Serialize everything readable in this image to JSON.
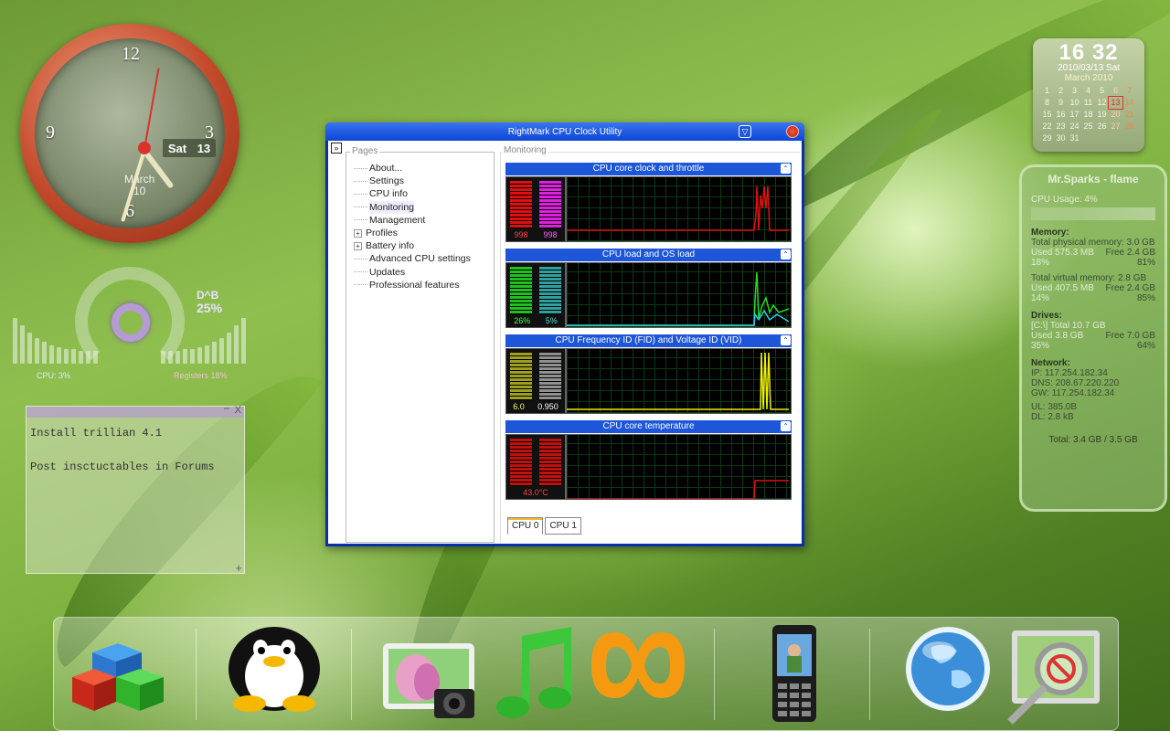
{
  "clock": {
    "numbers": [
      "12",
      "3",
      "6",
      "9"
    ],
    "day": "Sat",
    "date": "13",
    "month": "March",
    "month_day": "10"
  },
  "meter": {
    "title": "D^B",
    "percent": "25%",
    "cpu_label": "CPU: 3%",
    "register_label": "Registers 18%"
  },
  "notes": {
    "lines": [
      "Install trillian 4.1",
      "Post insctuctables in Forums"
    ]
  },
  "calendar": {
    "time": "16 32",
    "date": "2010/03/13 Sat",
    "month": "March 2010",
    "days": [
      [
        "1",
        "2",
        "3",
        "4",
        "5",
        "6",
        "7"
      ],
      [
        "8",
        "9",
        "10",
        "11",
        "12",
        "13",
        "14"
      ],
      [
        "15",
        "16",
        "17",
        "18",
        "19",
        "20",
        "21"
      ],
      [
        "22",
        "23",
        "24",
        "25",
        "26",
        "27",
        "28"
      ],
      [
        "29",
        "30",
        "31",
        "",
        "",
        "",
        ""
      ]
    ],
    "today": "13"
  },
  "stats": {
    "title": "Mr.Sparks - flame",
    "cpu_usage": "CPU Usage: 4%",
    "memory_heading": "Memory:",
    "physical_total": "Total physical memory: 3.0 GB",
    "physical_used": "Used 575.3 MB",
    "physical_free": "Free 2.4 GB",
    "physical_used_pct": "18%",
    "physical_free_pct": "81%",
    "virtual_total": "Total virtual memory: 2.8 GB",
    "virtual_used": "Used 407.5 MB",
    "virtual_free": "Free 2.4 GB",
    "virtual_used_pct": "14%",
    "virtual_free_pct": "85%",
    "drives_heading": "Drives:",
    "drive_total": "[C:\\] Total 10.7 GB",
    "drive_used": "Used 3.8 GB",
    "drive_free": "Free 7.0 GB",
    "drive_used_pct": "35%",
    "drive_free_pct": "64%",
    "network_heading": "Network:",
    "ip": "IP:   117.254.182.34",
    "dns": "DNS: 208.67.220.220",
    "gw": "GW:  117.254.182.34",
    "ul": "UL: 385.0B",
    "dl": "DL: 2.8 kB",
    "total": "Total: 3.4 GB / 3.5 GB"
  },
  "window": {
    "title": "RightMark CPU Clock Utility",
    "pages_label": "Pages",
    "monitoring_label": "Monitoring",
    "tree": [
      {
        "label": "About...",
        "expandable": false
      },
      {
        "label": "Settings",
        "expandable": false
      },
      {
        "label": "CPU info",
        "expandable": false
      },
      {
        "label": "Monitoring",
        "expandable": false,
        "selected": true
      },
      {
        "label": "Management",
        "expandable": false
      },
      {
        "label": "Profiles",
        "expandable": true
      },
      {
        "label": "Battery info",
        "expandable": true
      },
      {
        "label": "Advanced CPU settings",
        "expandable": false
      },
      {
        "label": "Updates",
        "expandable": false
      },
      {
        "label": "Professional features",
        "expandable": false
      }
    ],
    "panels": [
      {
        "title": "CPU core clock and throttle",
        "values": [
          "998",
          "998"
        ],
        "colors": [
          "#e01010",
          "#e020e0"
        ],
        "value_colors": [
          "#ff4040",
          "#ff60ff"
        ]
      },
      {
        "title": "CPU load and OS load",
        "values": [
          "26%",
          "5%"
        ],
        "colors": [
          "#20c020",
          "#30a0a0"
        ],
        "value_colors": [
          "#40ff40",
          "#40e0e0"
        ]
      },
      {
        "title": "CPU Frequency ID (FID) and Voltage ID (VID)",
        "values": [
          "6.0",
          "0.950"
        ],
        "colors": [
          "#a0a020",
          "#909090"
        ],
        "value_colors": [
          "#ffff60",
          "#ffffff"
        ]
      },
      {
        "title": "CPU core temperature",
        "values": [
          "43.0°C"
        ],
        "colors": [
          "#c01010",
          "#c01010"
        ],
        "value_colors": [
          "#ff4040"
        ]
      }
    ],
    "tabs": [
      "CPU 0",
      "CPU 1"
    ],
    "active_tab": "CPU 0"
  },
  "dock": {
    "items": [
      "cubes-icon",
      "penguin-icon",
      "photo-camera-icon",
      "music-note-icon",
      "orange-loop-icon",
      "mobile-phone-icon",
      "globe-icon",
      "magnifier-monitor-icon"
    ]
  }
}
